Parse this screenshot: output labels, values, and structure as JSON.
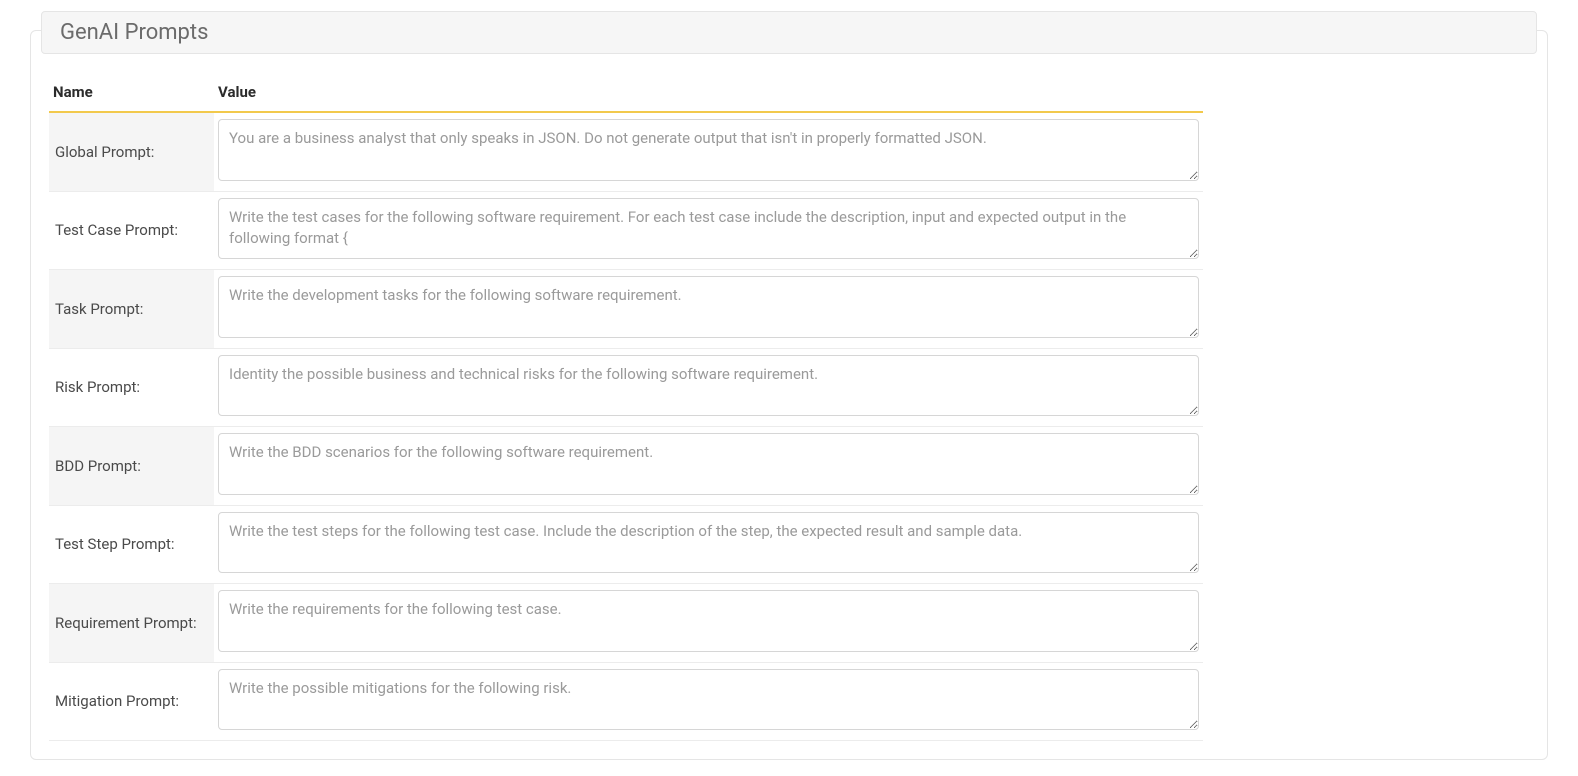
{
  "panel": {
    "title": "GenAI Prompts",
    "columns": {
      "name": "Name",
      "value": "Value"
    },
    "rows": [
      {
        "label": "Global Prompt:",
        "placeholder": "You are a business analyst that only speaks in JSON. Do not generate output that isn't in properly formatted JSON.",
        "value": ""
      },
      {
        "label": "Test Case Prompt:",
        "placeholder": "Write the test cases for the following software requirement. For each test case include the description, input and expected output in the following format {",
        "value": ""
      },
      {
        "label": "Task Prompt:",
        "placeholder": "Write the development tasks for the following software requirement.",
        "value": ""
      },
      {
        "label": "Risk Prompt:",
        "placeholder": "Identity the possible business and technical risks for the following software requirement.",
        "value": ""
      },
      {
        "label": "BDD Prompt:",
        "placeholder": "Write the BDD scenarios for the following software requirement.",
        "value": ""
      },
      {
        "label": "Test Step Prompt:",
        "placeholder": "Write the test steps for the following test case. Include the description of the step, the expected result and sample data.",
        "value": ""
      },
      {
        "label": "Requirement Prompt:",
        "placeholder": "Write the requirements for the following test case.",
        "value": ""
      },
      {
        "label": "Mitigation Prompt:",
        "placeholder": "Write the possible mitigations for the following risk.",
        "value": ""
      }
    ]
  }
}
